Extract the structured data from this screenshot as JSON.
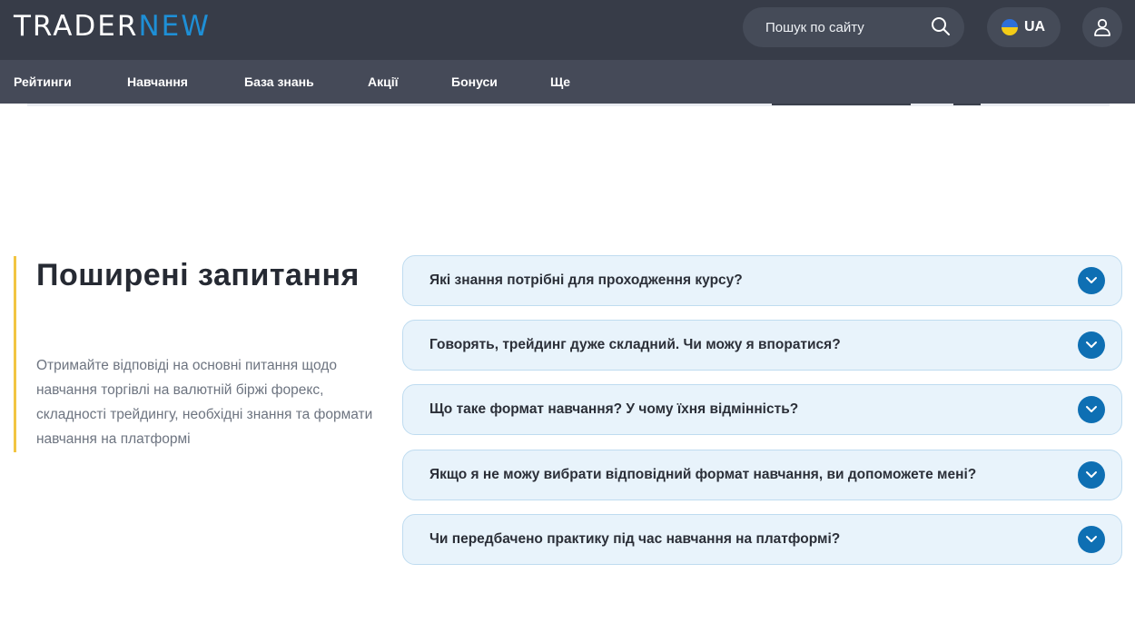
{
  "header": {
    "logo": {
      "part1": "TRADER",
      "part2": "NEW"
    },
    "search": {
      "placeholder": "Пошук по сайту"
    },
    "language": {
      "code": "UA"
    }
  },
  "nav": {
    "items": [
      {
        "label": "Рейтинги"
      },
      {
        "label": "Навчання"
      },
      {
        "label": "База знань"
      },
      {
        "label": "Акції"
      },
      {
        "label": "Бонуси"
      },
      {
        "label": "Ще"
      }
    ]
  },
  "faq": {
    "title": "Поширені запитання",
    "description": "Отримайте відповіді на основні питання щодо навчання торгівлі на валютній біржі форекс, складності трейдингу, необхідні знання та формати навчання на платформі",
    "items": [
      {
        "question": "Які знання потрібні для проходження курсу?"
      },
      {
        "question": "Говорять, трейдинг дуже складний. Чи можу я впоратися?"
      },
      {
        "question": "Що таке формат навчання? У чому їхня відмінність?"
      },
      {
        "question": "Якщо я не можу вибрати відповідний формат навчання, ви допоможете мені?"
      },
      {
        "question": "Чи передбачено практику під час навчання на платформі?"
      }
    ]
  },
  "colors": {
    "header_bg": "#373c48",
    "nav_bg": "#454a58",
    "brand_blue": "#1e8fd6",
    "accent_yellow": "#f2c542",
    "faq_bg": "#e8f3fb",
    "chevron_bg": "#0e6fb3"
  },
  "icons": {
    "search": "search-icon",
    "user": "user-icon",
    "flag": "ukraine-flag-icon",
    "expand": "chevron-down-icon"
  }
}
